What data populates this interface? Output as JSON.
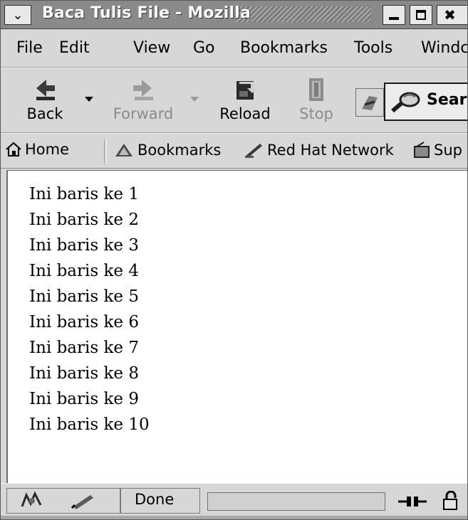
{
  "window": {
    "title": "Baca Tulis File - Mozilla"
  },
  "menubar": {
    "items": [
      "File",
      "Edit",
      "View",
      "Go",
      "Bookmarks",
      "Tools",
      "Windc"
    ]
  },
  "navbar": {
    "back": "Back",
    "forward": "Forward",
    "reload": "Reload",
    "stop": "Stop",
    "search": "Searc"
  },
  "personal_toolbar": {
    "items": [
      "Home",
      "Bookmarks",
      "Red Hat Network",
      "Sup"
    ]
  },
  "content": {
    "lines": [
      "Ini baris ke 1",
      "Ini baris ke 2",
      "Ini baris ke 3",
      "Ini baris ke 4",
      "Ini baris ke 5",
      "Ini baris ke 6",
      "Ini baris ke 7",
      "Ini baris ke 8",
      "Ini baris ke 9",
      "Ini baris ke 10"
    ]
  },
  "statusbar": {
    "status": "Done",
    "progress": 0.0
  },
  "icons": {
    "window_menu": "chevron-down-icon",
    "minimize": "minimize-icon",
    "maximize": "maximize-icon",
    "close": "close-icon",
    "back": "back-arrow-icon",
    "forward": "forward-arrow-icon",
    "reload": "reload-icon",
    "stop": "stop-icon",
    "throbber": "throbber-icon",
    "search": "search-icon",
    "home": "home-icon",
    "bookmarks": "bookmarks-icon",
    "redhat": "redhat-network-icon",
    "support": "support-icon",
    "navigator": "navigator-icon",
    "composer": "composer-icon",
    "connection": "connection-icon",
    "security": "lock-icon"
  }
}
